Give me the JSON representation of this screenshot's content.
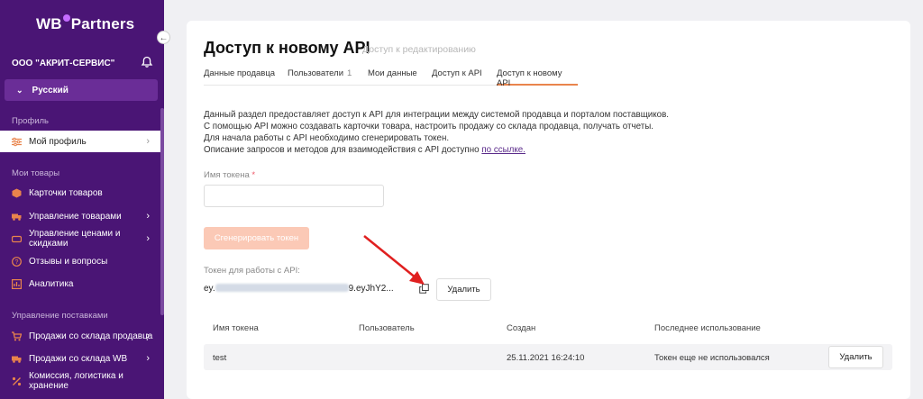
{
  "logo": {
    "left": "WB",
    "right": "Partners"
  },
  "company": "ООО \"АКРИТ-СЕРВИС\"",
  "language": "Русский",
  "sidebar": {
    "section_profile": "Профиль",
    "my_profile": "Мой профиль",
    "section_goods": "Мои товары",
    "items_goods": [
      "Карточки товаров",
      "Управление товарами",
      "Управление ценами и скидками",
      "Отзывы и вопросы",
      "Аналитика"
    ],
    "section_supply": "Управление поставками",
    "items_supply": [
      "Продажи со склада продавца",
      "Продажи со склада WB",
      "Комиссия, логистика и хранение"
    ]
  },
  "page": {
    "title": "Доступ к новому API",
    "subtitle": "Доступ к редактированию",
    "tabs": [
      {
        "label": "Данные продавца"
      },
      {
        "label": "Пользователи",
        "count": "1"
      },
      {
        "label": "Мои данные"
      },
      {
        "label": "Доступ к API"
      },
      {
        "label": "Доступ к новому API"
      }
    ],
    "description": [
      "Данный раздел предоставляет доступ к API для интеграции между системой продавца и порталом поставщиков.",
      "С помощью API можно создавать карточки товара, настроить продажу со склада продавца, получать отчеты.",
      "Для начала работы с API необходимо сгенерировать токен.",
      "Описание запросов и методов для взаимодействия с API доступно"
    ],
    "link_text": "по ссылке.",
    "token_name_label": "Имя токена",
    "required_mark": "*",
    "token_name_value": "",
    "generate_label": "Сгенерировать токен",
    "token_label": "Токен для работы с API:",
    "token_prefix": "ey.",
    "token_suffix": "9.eyJhY2...",
    "delete_label": "Удалить",
    "table": {
      "headers": [
        "Имя токена",
        "Пользователь",
        "Создан",
        "Последнее использование"
      ],
      "rows": [
        {
          "name": "test",
          "user": "",
          "created": "25.11.2021 16:24:10",
          "last_used": "Токен еще не использовался",
          "action": "Удалить"
        }
      ]
    }
  },
  "colors": {
    "sidebar": "#4a1575",
    "accent": "#e9844c",
    "button_disabled": "#fbc9b6",
    "annotation": "#e02020"
  }
}
